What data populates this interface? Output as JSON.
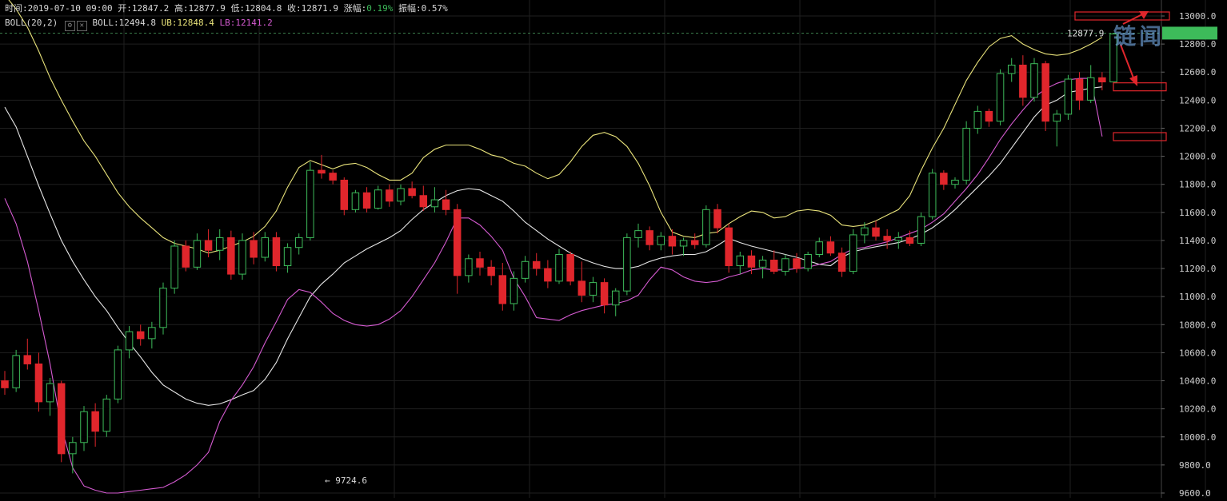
{
  "header": {
    "time_label": "时间:",
    "time": "2019-07-10 09:00",
    "open_label": "开:",
    "open": "12847.2",
    "high_label": "高:",
    "high": "12877.9",
    "low_label": "低:",
    "low": "12804.8",
    "close_label": "收:",
    "close": "12871.9",
    "change_label": "涨幅:",
    "change": "0.19%",
    "amplitude_label": "振幅:",
    "amplitude": "0.57%",
    "indicator": "BOLL(20,2)",
    "boll_label": "BOLL:",
    "boll": "12494.8",
    "ub_label": "UB:",
    "ub": "12848.4",
    "lb_label": "LB:",
    "lb": "12141.2"
  },
  "watermark": "链闻",
  "colors": {
    "up": "#3dbb5a",
    "down": "#e0262c",
    "mid": "#e6e6e6",
    "upper": "#e8e27a",
    "lower": "#d45ad0",
    "grid": "#1f1f1f",
    "axis_text": "#d0d0d0",
    "annotation": "#e0262c"
  },
  "chart_data": {
    "type": "candlestick",
    "ylim": [
      9600,
      13000
    ],
    "yticks": [
      "13000.0",
      "12800.0",
      "12600.0",
      "12400.0",
      "12200.0",
      "12000.0",
      "11800.0",
      "11600.0",
      "11400.0",
      "11200.0",
      "11000.0",
      "10800.0",
      "10600.0",
      "10400.0",
      "10200.0",
      "10000.0",
      "9800.0",
      "9600.0"
    ],
    "last_price": 12877.9,
    "last_price_label": "12877.9",
    "min_marker_label": "← 9724.6",
    "min_marker": {
      "index": 28,
      "value": 9724.6
    },
    "annotation_boxes": [
      {
        "value": 13000
      },
      {
        "value": 12495
      },
      {
        "value": 12140
      }
    ],
    "mid": [
      12350,
      12210,
      12000,
      11790,
      11590,
      11400,
      11250,
      11120,
      11000,
      10900,
      10780,
      10670,
      10570,
      10460,
      10370,
      10320,
      10270,
      10240,
      10225,
      10235,
      10265,
      10300,
      10330,
      10410,
      10530,
      10700,
      10850,
      11000,
      11090,
      11160,
      11240,
      11290,
      11340,
      11380,
      11420,
      11470,
      11550,
      11620,
      11670,
      11720,
      11755,
      11770,
      11760,
      11720,
      11680,
      11610,
      11530,
      11470,
      11410,
      11360,
      11310,
      11270,
      11240,
      11215,
      11200,
      11200,
      11215,
      11250,
      11275,
      11290,
      11300,
      11300,
      11320,
      11365,
      11415,
      11385,
      11360,
      11340,
      11320,
      11300,
      11280,
      11255,
      11230,
      11220,
      11280,
      11320,
      11340,
      11355,
      11370,
      11385,
      11410,
      11445,
      11490,
      11550,
      11620,
      11700,
      11780,
      11860,
      11950,
      12060,
      12170,
      12280,
      12365,
      12400,
      12455,
      12470,
      12485,
      12495
    ],
    "upper": [
      13150,
      13050,
      12920,
      12750,
      12560,
      12400,
      12250,
      12110,
      12000,
      11870,
      11740,
      11640,
      11560,
      11490,
      11420,
      11380,
      11360,
      11340,
      11310,
      11330,
      11360,
      11390,
      11430,
      11500,
      11610,
      11780,
      11920,
      11970,
      11940,
      11910,
      11940,
      11950,
      11920,
      11870,
      11830,
      11830,
      11880,
      11990,
      12050,
      12080,
      12080,
      12080,
      12050,
      12010,
      11990,
      11950,
      11930,
      11880,
      11840,
      11870,
      11960,
      12070,
      12150,
      12170,
      12140,
      12070,
      11950,
      11790,
      11600,
      11460,
      11430,
      11420,
      11450,
      11460,
      11520,
      11570,
      11610,
      11600,
      11560,
      11570,
      11610,
      11620,
      11610,
      11580,
      11510,
      11500,
      11510,
      11540,
      11580,
      11620,
      11720,
      11900,
      12060,
      12200,
      12370,
      12540,
      12670,
      12780,
      12840,
      12860,
      12800,
      12760,
      12730,
      12720,
      12730,
      12760,
      12800,
      12848
    ],
    "lower": [
      11700,
      11520,
      11250,
      10900,
      10520,
      10070,
      9780,
      9650,
      9620,
      9600,
      9600,
      9610,
      9620,
      9630,
      9640,
      9680,
      9730,
      9800,
      9890,
      10110,
      10260,
      10370,
      10500,
      10670,
      10820,
      10980,
      11050,
      11030,
      10960,
      10880,
      10830,
      10800,
      10790,
      10800,
      10840,
      10900,
      11000,
      11120,
      11240,
      11390,
      11560,
      11560,
      11510,
      11430,
      11330,
      11130,
      11000,
      10850,
      10840,
      10830,
      10870,
      10900,
      10920,
      10940,
      10950,
      10970,
      11010,
      11120,
      11210,
      11190,
      11140,
      11110,
      11100,
      11110,
      11140,
      11160,
      11190,
      11200,
      11190,
      11190,
      11200,
      11210,
      11230,
      11250,
      11300,
      11340,
      11350,
      11370,
      11390,
      11420,
      11450,
      11480,
      11530,
      11590,
      11680,
      11770,
      11870,
      11990,
      12120,
      12230,
      12330,
      12420,
      12480,
      12520,
      12545,
      12555,
      12555,
      12141
    ],
    "ohlc": [
      [
        10400,
        10470,
        10300,
        10350
      ],
      [
        10350,
        10620,
        10320,
        10580
      ],
      [
        10580,
        10700,
        10480,
        10520
      ],
      [
        10520,
        10600,
        10180,
        10250
      ],
      [
        10250,
        10420,
        10150,
        10380
      ],
      [
        10380,
        10400,
        9820,
        9880
      ],
      [
        9880,
        10000,
        9740,
        9960
      ],
      [
        9960,
        10220,
        9900,
        10180
      ],
      [
        10180,
        10240,
        9930,
        10040
      ],
      [
        10040,
        10300,
        10000,
        10270
      ],
      [
        10270,
        10650,
        10240,
        10620
      ],
      [
        10620,
        10790,
        10560,
        10750
      ],
      [
        10750,
        10800,
        10650,
        10700
      ],
      [
        10700,
        10820,
        10630,
        10780
      ],
      [
        10780,
        11100,
        10730,
        11060
      ],
      [
        11060,
        11400,
        11020,
        11360
      ],
      [
        11360,
        11400,
        11180,
        11210
      ],
      [
        11210,
        11450,
        11190,
        11400
      ],
      [
        11400,
        11480,
        11280,
        11330
      ],
      [
        11330,
        11480,
        11260,
        11420
      ],
      [
        11420,
        11470,
        11120,
        11160
      ],
      [
        11160,
        11450,
        11120,
        11400
      ],
      [
        11400,
        11460,
        11230,
        11280
      ],
      [
        11280,
        11460,
        11250,
        11420
      ],
      [
        11420,
        11460,
        11180,
        11220
      ],
      [
        11220,
        11380,
        11170,
        11350
      ],
      [
        11350,
        11450,
        11300,
        11420
      ],
      [
        11420,
        11960,
        11400,
        11900
      ],
      [
        11900,
        12010,
        11840,
        11880
      ],
      [
        11880,
        11900,
        11800,
        11830
      ],
      [
        11830,
        11850,
        11580,
        11620
      ],
      [
        11620,
        11760,
        11600,
        11740
      ],
      [
        11740,
        11780,
        11600,
        11630
      ],
      [
        11630,
        11790,
        11620,
        11760
      ],
      [
        11760,
        11800,
        11640,
        11680
      ],
      [
        11680,
        11800,
        11650,
        11770
      ],
      [
        11770,
        11820,
        11700,
        11720
      ],
      [
        11720,
        11790,
        11610,
        11640
      ],
      [
        11640,
        11780,
        11600,
        11690
      ],
      [
        11690,
        11760,
        11580,
        11620
      ],
      [
        11620,
        11660,
        11020,
        11150
      ],
      [
        11150,
        11300,
        11100,
        11270
      ],
      [
        11270,
        11320,
        11150,
        11210
      ],
      [
        11210,
        11260,
        11080,
        11150
      ],
      [
        11150,
        11240,
        10900,
        10950
      ],
      [
        10950,
        11180,
        10900,
        11130
      ],
      [
        11130,
        11290,
        11100,
        11250
      ],
      [
        11250,
        11310,
        11150,
        11200
      ],
      [
        11200,
        11260,
        11060,
        11110
      ],
      [
        11110,
        11340,
        11090,
        11300
      ],
      [
        11300,
        11320,
        11080,
        11110
      ],
      [
        11110,
        11250,
        10960,
        11010
      ],
      [
        11010,
        11140,
        10960,
        11100
      ],
      [
        11100,
        11130,
        10880,
        10940
      ],
      [
        10940,
        11060,
        10860,
        11040
      ],
      [
        11040,
        11450,
        11010,
        11420
      ],
      [
        11420,
        11520,
        11350,
        11470
      ],
      [
        11470,
        11500,
        11330,
        11370
      ],
      [
        11370,
        11460,
        11330,
        11430
      ],
      [
        11430,
        11480,
        11300,
        11360
      ],
      [
        11360,
        11420,
        11290,
        11400
      ],
      [
        11400,
        11450,
        11340,
        11370
      ],
      [
        11370,
        11650,
        11350,
        11620
      ],
      [
        11620,
        11660,
        11450,
        11490
      ],
      [
        11490,
        11520,
        11170,
        11220
      ],
      [
        11220,
        11320,
        11160,
        11290
      ],
      [
        11290,
        11330,
        11160,
        11210
      ],
      [
        11210,
        11290,
        11130,
        11260
      ],
      [
        11260,
        11330,
        11160,
        11180
      ],
      [
        11180,
        11300,
        11150,
        11270
      ],
      [
        11270,
        11310,
        11170,
        11200
      ],
      [
        11200,
        11320,
        11180,
        11300
      ],
      [
        11300,
        11420,
        11280,
        11390
      ],
      [
        11390,
        11430,
        11290,
        11310
      ],
      [
        11310,
        11350,
        11140,
        11180
      ],
      [
        11180,
        11480,
        11160,
        11440
      ],
      [
        11440,
        11530,
        11380,
        11490
      ],
      [
        11490,
        11540,
        11400,
        11430
      ],
      [
        11430,
        11480,
        11340,
        11400
      ],
      [
        11400,
        11460,
        11340,
        11420
      ],
      [
        11420,
        11470,
        11360,
        11380
      ],
      [
        11380,
        11600,
        11360,
        11570
      ],
      [
        11570,
        11910,
        11550,
        11880
      ],
      [
        11880,
        11900,
        11760,
        11800
      ],
      [
        11800,
        11850,
        11770,
        11830
      ],
      [
        11830,
        12250,
        11800,
        12200
      ],
      [
        12200,
        12360,
        12160,
        12320
      ],
      [
        12320,
        12340,
        12210,
        12250
      ],
      [
        12250,
        12620,
        12220,
        12590
      ],
      [
        12590,
        12700,
        12530,
        12650
      ],
      [
        12650,
        12720,
        12360,
        12420
      ],
      [
        12420,
        12700,
        12390,
        12660
      ],
      [
        12660,
        12680,
        12180,
        12250
      ],
      [
        12250,
        12330,
        12070,
        12300
      ],
      [
        12300,
        12580,
        12260,
        12550
      ],
      [
        12550,
        12600,
        12330,
        12400
      ],
      [
        12400,
        12650,
        12380,
        12560
      ],
      [
        12560,
        12600,
        12470,
        12530
      ],
      [
        12530,
        12880,
        12500,
        12872
      ]
    ]
  }
}
